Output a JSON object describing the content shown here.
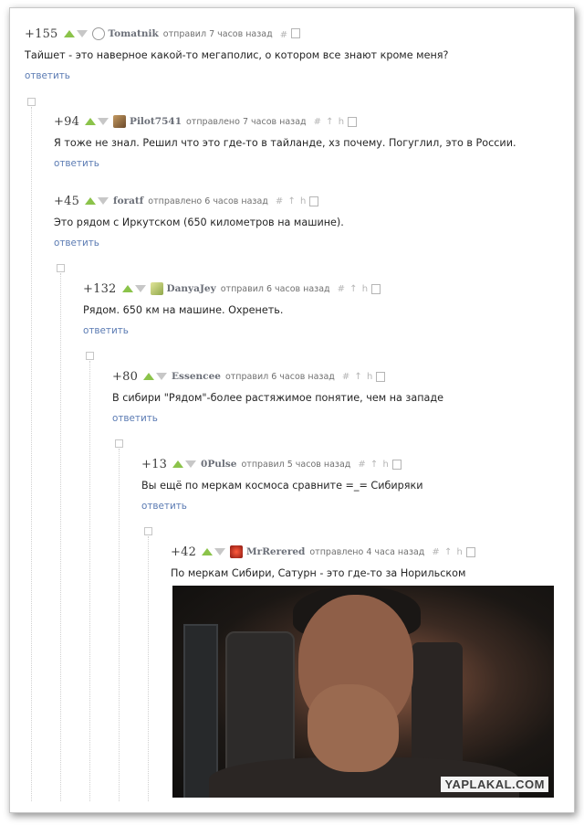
{
  "actions": {
    "reply": "ответить",
    "tools": "# ↑ h"
  },
  "comments": [
    {
      "score": "+155",
      "author": "Tomatnik",
      "sent": "отправил 7 часов назад",
      "text": "Тайшет - это наверное какой-то мегаполис, о котором все знают кроме меня?",
      "avatar_color": "#9a9a9a"
    },
    {
      "score": "+94",
      "author": "Pilot7541",
      "sent": "отправлено 7 часов назад",
      "text": "Я тоже не знал. Решил что это где-то в тайланде, хз почему. Погуглил, это в России.",
      "avatar_color": "#8a6a45"
    },
    {
      "score": "+45",
      "author": "foratf",
      "sent": "отправлено 6 часов назад",
      "text": "Это рядом с Иркутском (650 километров на машине).",
      "avatar_color": ""
    },
    {
      "score": "+132",
      "author": "DanyaJey",
      "sent": "отправил 6 часов назад",
      "text": "Рядом. 650 км на машине. Охренеть.",
      "avatar_color": "#b8c470"
    },
    {
      "score": "+80",
      "author": "Essencee",
      "sent": "отправил 6 часов назад",
      "text": "В сибири \"Рядом\"-более растяжимое понятие, чем на западе",
      "avatar_color": ""
    },
    {
      "score": "+13",
      "author": "0Pulse",
      "sent": "отправил 5 часов назад",
      "text": "Вы ещё по меркам космоса сравните =_= Сибиряки",
      "avatar_color": ""
    },
    {
      "score": "+42",
      "author": "MrRerered",
      "sent": "отправлено 4 часа назад",
      "text": "По меркам Сибири, Сатурн - это где-то за Норильском",
      "avatar_color": "#c0281e"
    }
  ],
  "image": {
    "watermark": "YAPLAKAL.COM"
  },
  "colors": {
    "vote_up": "#8bc34a",
    "vote_down": "#c7c7c7",
    "reply_link": "#5b7bb3"
  }
}
